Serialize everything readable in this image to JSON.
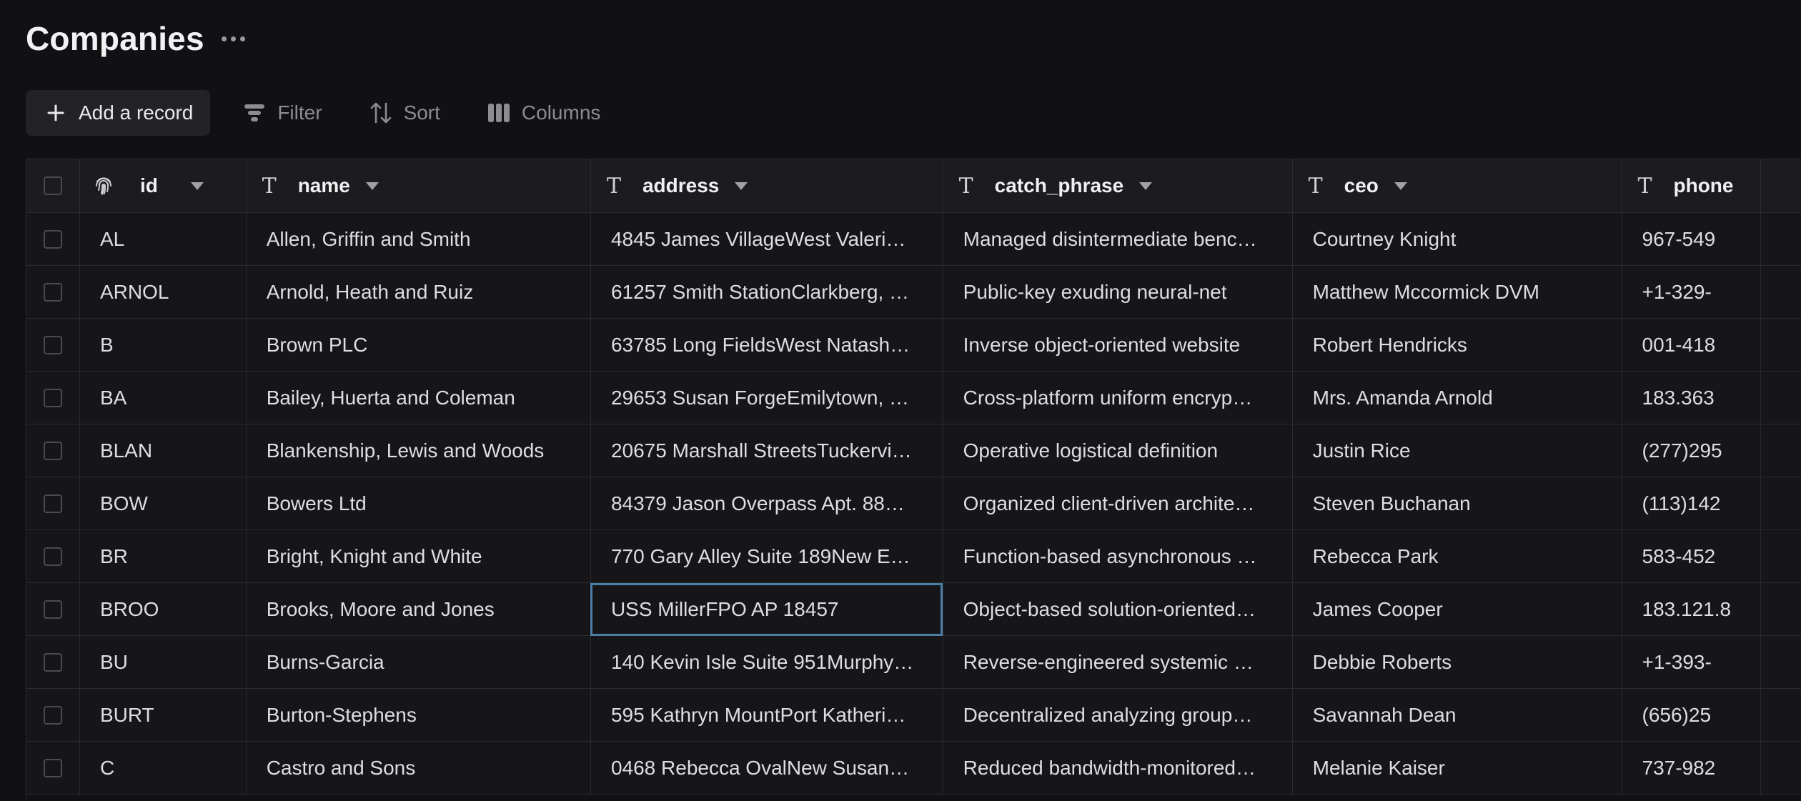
{
  "page": {
    "title": "Companies"
  },
  "toolbar": {
    "add_label": "Add a record",
    "filter_label": "Filter",
    "sort_label": "Sort",
    "columns_label": "Columns"
  },
  "columns": [
    {
      "key": "id",
      "label": "id",
      "type_icon": "fingerprint-icon"
    },
    {
      "key": "name",
      "label": "name",
      "type_icon": "text-type-icon"
    },
    {
      "key": "address",
      "label": "address",
      "type_icon": "text-type-icon"
    },
    {
      "key": "catch_phrase",
      "label": "catch_phrase",
      "type_icon": "text-type-icon"
    },
    {
      "key": "ceo",
      "label": "ceo",
      "type_icon": "text-type-icon"
    },
    {
      "key": "phone",
      "label": "phone",
      "type_icon": "text-type-icon"
    }
  ],
  "rows": [
    {
      "id": "AL",
      "name": "Allen, Griffin and Smith",
      "address": "4845 James VillageWest Valeri…",
      "catch_phrase": "Managed disintermediate benc…",
      "ceo": "Courtney Knight",
      "phone": "967-549"
    },
    {
      "id": "ARNOL",
      "name": "Arnold, Heath and Ruiz",
      "address": "61257 Smith StationClarkberg, …",
      "catch_phrase": "Public-key exuding neural-net",
      "ceo": "Matthew Mccormick DVM",
      "phone": "+1-329-"
    },
    {
      "id": "B",
      "name": "Brown PLC",
      "address": "63785 Long FieldsWest Natash…",
      "catch_phrase": "Inverse object-oriented website",
      "ceo": "Robert Hendricks",
      "phone": "001-418"
    },
    {
      "id": "BA",
      "name": "Bailey, Huerta and Coleman",
      "address": "29653 Susan ForgeEmilytown, …",
      "catch_phrase": "Cross-platform uniform encryp…",
      "ceo": "Mrs. Amanda Arnold",
      "phone": "183.363"
    },
    {
      "id": "BLAN",
      "name": "Blankenship, Lewis and Woods",
      "address": "20675 Marshall StreetsTuckervi…",
      "catch_phrase": "Operative logistical definition",
      "ceo": "Justin Rice",
      "phone": "(277)295"
    },
    {
      "id": "BOW",
      "name": "Bowers Ltd",
      "address": "84379 Jason Overpass Apt. 88…",
      "catch_phrase": "Organized client-driven archite…",
      "ceo": "Steven Buchanan",
      "phone": "(113)142"
    },
    {
      "id": "BR",
      "name": "Bright, Knight and White",
      "address": "770 Gary Alley Suite 189New E…",
      "catch_phrase": "Function-based asynchronous …",
      "ceo": "Rebecca Park",
      "phone": "583-452"
    },
    {
      "id": "BROO",
      "name": "Brooks, Moore and Jones",
      "address": "USS MillerFPO AP 18457",
      "catch_phrase": "Object-based solution-oriented…",
      "ceo": "James Cooper",
      "phone": "183.121.8"
    },
    {
      "id": "BU",
      "name": "Burns-Garcia",
      "address": "140 Kevin Isle Suite 951Murphy…",
      "catch_phrase": "Reverse-engineered systemic …",
      "ceo": "Debbie Roberts",
      "phone": "+1-393-"
    },
    {
      "id": "BURT",
      "name": "Burton-Stephens",
      "address": "595 Kathryn MountPort Katheri…",
      "catch_phrase": "Decentralized analyzing group…",
      "ceo": "Savannah Dean",
      "phone": "(656)25"
    },
    {
      "id": "C",
      "name": "Castro and Sons",
      "address": "0468 Rebecca OvalNew Susan…",
      "catch_phrase": "Reduced bandwidth-monitored…",
      "ceo": "Melanie Kaiser",
      "phone": "737-982"
    }
  ],
  "selected_cell": {
    "row": 7,
    "column": "address"
  },
  "colors": {
    "background": "#111113",
    "header": "#1c1c1f",
    "selection": "#4b7fa8"
  }
}
